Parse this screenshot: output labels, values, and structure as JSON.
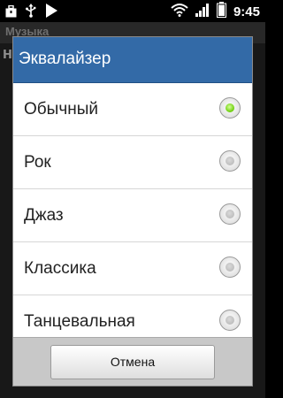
{
  "status_bar": {
    "left_icons": [
      "briefcase-icon",
      "usb-icon",
      "play-icon"
    ],
    "right_icons": [
      "wifi-icon",
      "signal-icon",
      "battery-icon"
    ],
    "time": "9:45"
  },
  "app": {
    "title": "Музыка",
    "peek_text": "Н"
  },
  "dialog": {
    "title": "Эквалайзер",
    "options": [
      {
        "label": "Обычный",
        "selected": true
      },
      {
        "label": "Рок",
        "selected": false
      },
      {
        "label": "Джаз",
        "selected": false
      },
      {
        "label": "Классика",
        "selected": false
      },
      {
        "label": "Танцевальная",
        "selected": false
      }
    ],
    "cancel_label": "Отмена"
  },
  "colors": {
    "title_bar": "#336aa7",
    "radio_selected": "#6fd00f"
  }
}
